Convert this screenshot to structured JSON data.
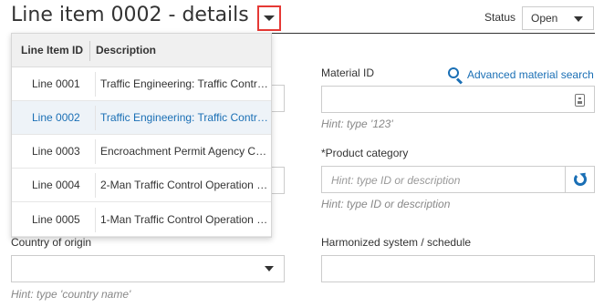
{
  "header": {
    "title": "Line item 0002 - details",
    "status_label": "Status",
    "status_value": "Open"
  },
  "material": {
    "label": "Material ID",
    "advanced_search": "Advanced material search",
    "value": "",
    "hint": "Hint: type '123'"
  },
  "product_category": {
    "label": "*Product category",
    "placeholder": "Hint: type ID or description",
    "hint": "Hint: type ID or description"
  },
  "country": {
    "label": "Country of origin",
    "value": "",
    "hint": "Hint: type 'country name'"
  },
  "harmonized": {
    "label": "Harmonized system / schedule",
    "value": ""
  },
  "line_dropdown": {
    "columns": [
      "Line Item ID",
      "Description"
    ],
    "rows": [
      {
        "id": "Line 0001",
        "description": "Traffic Engineering: Traffic Contro...",
        "selected": false
      },
      {
        "id": "Line 0002",
        "description": "Traffic Engineering: Traffic Control...",
        "selected": true
      },
      {
        "id": "Line 0003",
        "description": "Encroachment Permit Agency Co...",
        "selected": false
      },
      {
        "id": "Line 0004",
        "description": "2-Man Traffic Control Operation S...",
        "selected": false
      },
      {
        "id": "Line 0005",
        "description": "1-Man Traffic Control Operation S...",
        "selected": false
      }
    ]
  },
  "colors": {
    "accent": "#1a6fb5",
    "highlight_border": "#e53935",
    "selected_row_bg": "#eef3f8"
  }
}
